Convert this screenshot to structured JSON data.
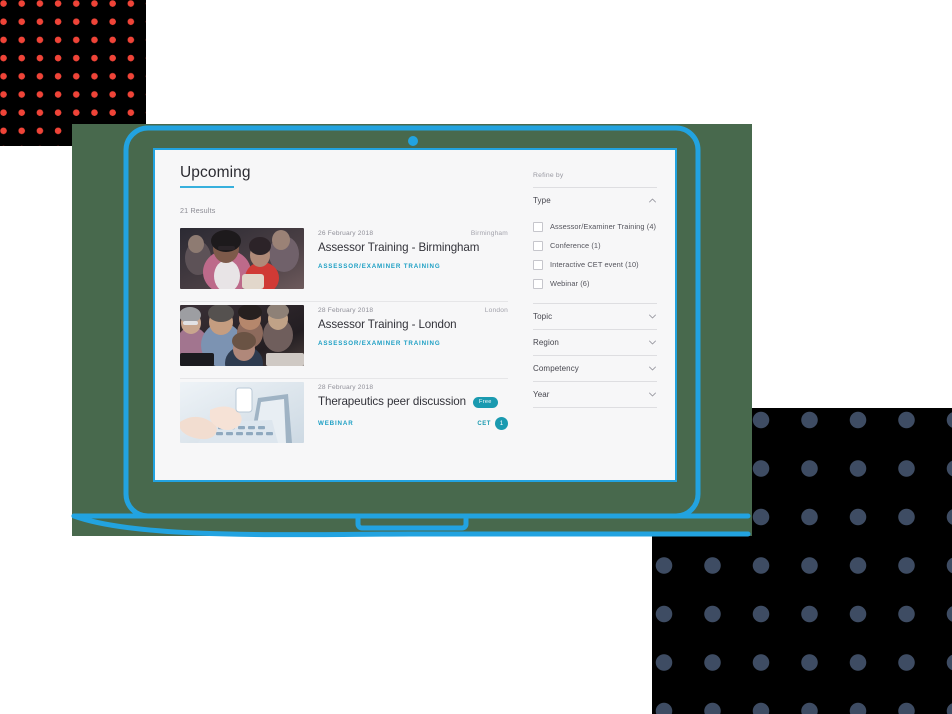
{
  "decor": {
    "red_dots_color": "#f04438",
    "slate_dots_color": "#3e4c63",
    "green_block_color": "#48694d",
    "laptop_outline_color": "#22a3e0",
    "camera_dot": "camera-dot"
  },
  "panel": {
    "title": "Upcoming",
    "result_count": "21 Results",
    "accent_color": "#37b0dd"
  },
  "events": [
    {
      "date": "26 February 2018",
      "location": "Birmingham",
      "title": "Assessor Training - Birmingham",
      "tag": "ASSESSOR/EXAMINER TRAINING",
      "image": "conference-audience-photo",
      "free": null,
      "cet_label": null,
      "cet_points": null
    },
    {
      "date": "28 February 2018",
      "location": "London",
      "title": "Assessor Training - London",
      "tag": "ASSESSOR/EXAMINER TRAINING",
      "image": "group-discussion-photo",
      "free": null,
      "cet_label": null,
      "cet_points": null
    },
    {
      "date": "28 February 2018",
      "location": "",
      "title": "Therapeutics peer discussion",
      "tag": "WEBINAR",
      "image": "hands-typing-laptop-photo",
      "free": "Free",
      "cet_label": "CET",
      "cet_points": "1"
    }
  ],
  "refine": {
    "heading": "Refine by",
    "groups": [
      {
        "name": "Type",
        "expanded": true,
        "options": [
          {
            "label": "Assessor/Examiner Training (4)",
            "checked": false
          },
          {
            "label": "Conference (1)",
            "checked": false
          },
          {
            "label": "Interactive CET event (10)",
            "checked": false
          },
          {
            "label": "Webinar (6)",
            "checked": false
          }
        ]
      },
      {
        "name": "Topic",
        "expanded": false,
        "options": []
      },
      {
        "name": "Region",
        "expanded": false,
        "options": []
      },
      {
        "name": "Competency",
        "expanded": false,
        "options": []
      },
      {
        "name": "Year",
        "expanded": false,
        "options": []
      }
    ]
  }
}
